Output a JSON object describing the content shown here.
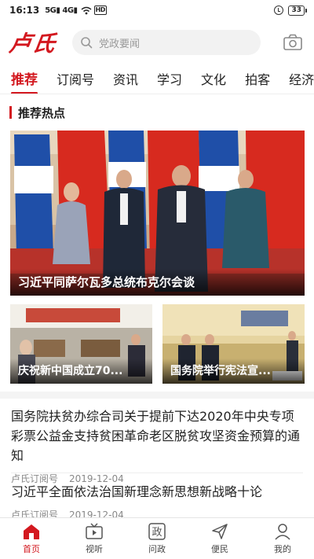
{
  "status_bar": {
    "time": "16:13",
    "signal1": "5G",
    "signal2": "4G",
    "wifi": "wifi-icon",
    "battery": "33"
  },
  "header": {
    "logo": "卢氏",
    "search_placeholder": "党政要闻",
    "camera_icon": "camera-icon"
  },
  "tabs": [
    "推荐",
    "订阅号",
    "资讯",
    "学习",
    "文化",
    "拍客",
    "经济"
  ],
  "active_tab": "推荐",
  "section": {
    "title": "推荐热点"
  },
  "hero": {
    "caption": "习近平同萨尔瓦多总统布克尔会谈"
  },
  "small_cards": [
    {
      "caption": "庆祝新中国成立70..."
    },
    {
      "caption": "国务院举行宪法宣..."
    }
  ],
  "articles": [
    {
      "title": "国务院扶贫办综合司关于提前下达2020年中央专项彩票公益金支持贫困革命老区脱贫攻坚资金预算的通知",
      "source": "卢氏订阅号",
      "date": "2019-12-04"
    },
    {
      "title": "习近平全面依法治国新理念新思想新战略十论",
      "source": "卢氏订阅号",
      "date": "2019-12-04"
    }
  ],
  "bottom_nav": [
    {
      "label": "首页",
      "icon": "home-icon"
    },
    {
      "label": "视听",
      "icon": "tv-icon"
    },
    {
      "label": "问政",
      "icon": "wenzheng-icon"
    },
    {
      "label": "便民",
      "icon": "send-icon"
    },
    {
      "label": "我的",
      "icon": "user-icon"
    }
  ],
  "colors": {
    "accent": "#d3181f",
    "text": "#222222",
    "meta": "#888888"
  }
}
